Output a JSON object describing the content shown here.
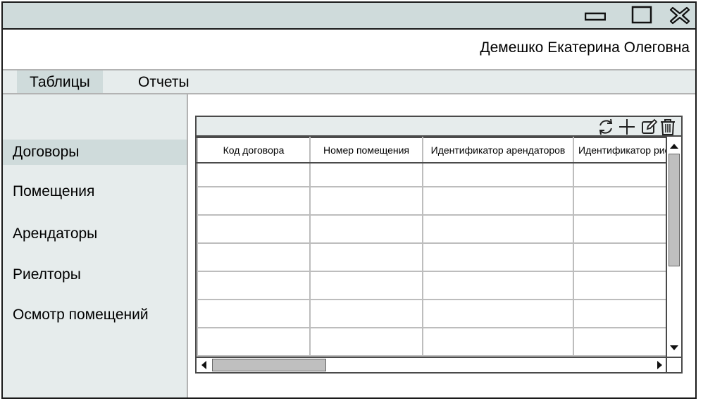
{
  "titlebar": {
    "minimize_icon": "minimize-icon",
    "maximize_icon": "maximize-icon",
    "close_icon": "close-icon"
  },
  "user": {
    "name": "Демешко Екатерина Олеговна"
  },
  "menu": {
    "items": [
      {
        "label": "Таблицы",
        "active": true
      },
      {
        "label": "Отчеты",
        "active": false
      }
    ]
  },
  "sidebar": {
    "items": [
      {
        "label": "Договоры",
        "active": true
      },
      {
        "label": "Помещения",
        "active": false
      },
      {
        "label": "Арендаторы",
        "active": false
      },
      {
        "label": "Риелторы",
        "active": false
      },
      {
        "label": "Осмотр помещений",
        "active": false
      }
    ]
  },
  "grid": {
    "toolbar": [
      "refresh-icon",
      "add-icon",
      "edit-icon",
      "delete-icon"
    ],
    "columns": [
      "Код договора",
      "Номер помещения",
      "Идентификатор арендаторов",
      "Идентификатор риелторов"
    ]
  },
  "colors": {
    "titlebar": "#cfdbdb",
    "panel": "#e6ecec",
    "active_item": "#cfdbdb",
    "border": "#1a1a1a"
  }
}
